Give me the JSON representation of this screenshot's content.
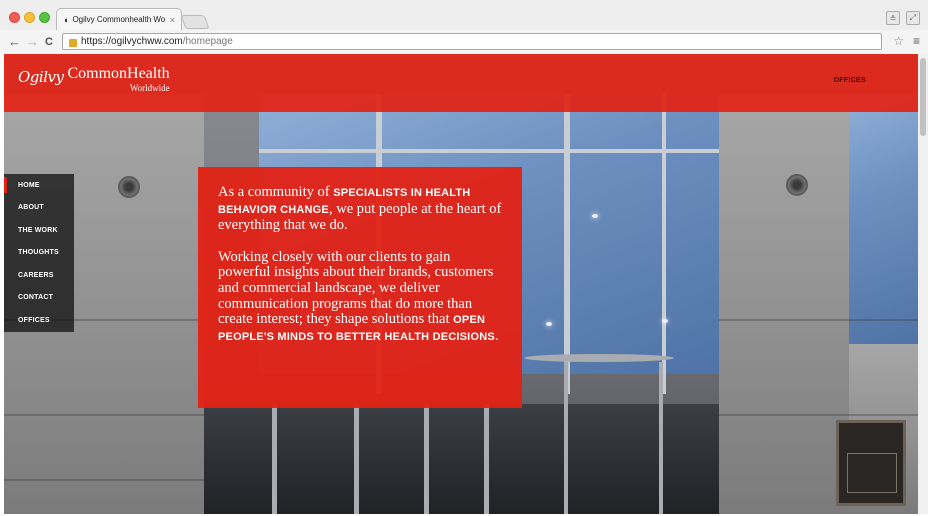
{
  "browser": {
    "tab_title": "Ogilvy Commonhealth Wo",
    "tab_close": "×",
    "url_scheme": "https://",
    "url_host": "ogilvychww.com",
    "url_path": "/homepage",
    "back_glyph": "←",
    "forward_glyph": "→",
    "reload_glyph": "C",
    "star_glyph": "☆",
    "menu_glyph": "≡",
    "user_glyph": "≗",
    "expand_glyph": "⤢"
  },
  "site": {
    "logo_script": "Ogilvy",
    "logo_main": "CommonHealth",
    "logo_sub": "Worldwide",
    "header_link": "OFFICES"
  },
  "nav": {
    "items": [
      {
        "label": "HOME",
        "active": true
      },
      {
        "label": "ABOUT"
      },
      {
        "label": "THE WORK"
      },
      {
        "label": "THOUGHTS"
      },
      {
        "label": "CAREERS"
      },
      {
        "label": "CONTACT"
      },
      {
        "label": "OFFICES"
      }
    ]
  },
  "content": {
    "p1_a": "As a community of ",
    "p1_caps": "SPECIALISTS IN HEALTH BEHAVIOR CHANGE",
    "p1_b": ", we put people at the heart of everything that we do.",
    "p2_a": "Working closely with our clients to gain powerful insights about their brands, customers and commercial landscape, we deliver communication programs that do more than create interest; they shape solutions that ",
    "p2_caps": "OPEN PEOPLE'S MINDS TO BETTER HEALTH DECISIONS",
    "p2_b": "."
  },
  "icons": {
    "favicon": "ogilvy-favicon",
    "lock": "lock-icon",
    "star": "bookmark-star-icon",
    "menu": "hamburger-menu-icon"
  },
  "colors": {
    "brand_red": "#e22215",
    "nav_bg": "#141416"
  }
}
